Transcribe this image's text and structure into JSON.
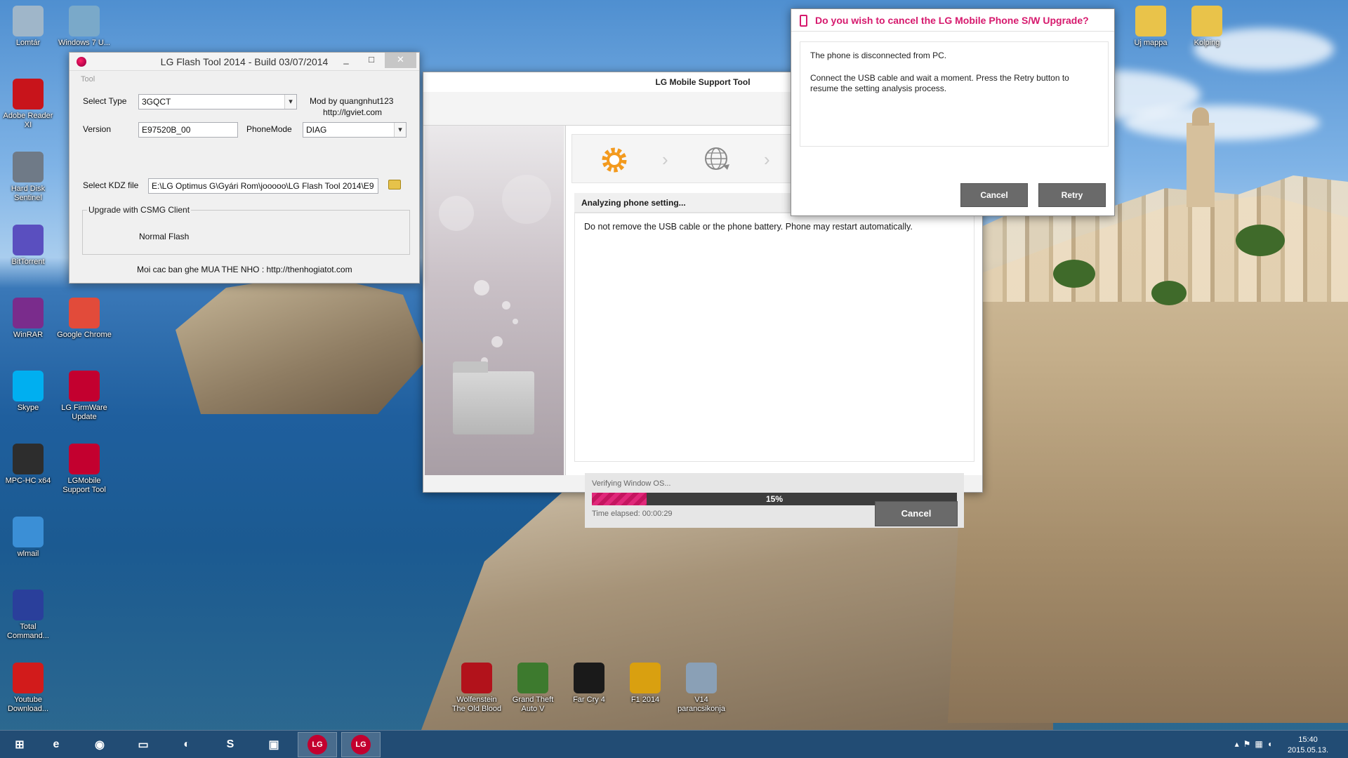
{
  "desktop": {
    "icons_left": [
      {
        "label": "Lomtár",
        "icon": "recycle-bin-icon",
        "color": "#9fb6c9"
      },
      {
        "label": "Adobe Reader XI",
        "icon": "pdf-icon",
        "color": "#c8141b"
      },
      {
        "label": "Hard Disk Sentinel",
        "icon": "hdd-icon",
        "color": "#6f7a87"
      },
      {
        "label": "BitTorrent",
        "icon": "bittorrent-icon",
        "color": "#5a4fbf"
      },
      {
        "label": "WinRAR",
        "icon": "winrar-icon",
        "color": "#7a2c8c"
      },
      {
        "label": "Skype",
        "icon": "skype-icon",
        "color": "#00aff0"
      },
      {
        "label": "MPC-HC x64",
        "icon": "media-player-icon",
        "color": "#2d2d2d"
      },
      {
        "label": "wlmail",
        "icon": "mail-icon",
        "color": "#3b8fd6"
      },
      {
        "label": "Total Command...",
        "icon": "floppy-icon",
        "color": "#2a3f9b"
      },
      {
        "label": "Youtube Download...",
        "icon": "youtube-icon",
        "color": "#d21b1b"
      }
    ],
    "icons_second": [
      {
        "label": "Windows 7 U...",
        "icon": "windows-icon",
        "color": "#7aa9c9"
      },
      {
        "label": "Google Chrome",
        "icon": "chrome-icon",
        "color": "#e24b3a"
      },
      {
        "label": "LG FirmWare Update",
        "icon": "lg-firmware-icon",
        "color": "#c3002f"
      },
      {
        "label": "LGMobile Support Tool",
        "icon": "lg-support-icon",
        "color": "#c3002f"
      }
    ],
    "icons_top_right": [
      {
        "label": "Uj mappa",
        "icon": "folder-icon",
        "color": "#e9c34a"
      },
      {
        "label": "Kolping",
        "icon": "folder-icon",
        "color": "#e9c34a"
      }
    ],
    "icons_bottom": [
      {
        "label": "Wolfenstein The Old Blood",
        "icon": "wolfenstein-icon",
        "color": "#b2121b"
      },
      {
        "label": "Grand Theft Auto V",
        "icon": "gta-icon",
        "color": "#3d7a2e"
      },
      {
        "label": "Far Cry 4",
        "icon": "farcry-icon",
        "color": "#1a1a1a"
      },
      {
        "label": "F1 2014",
        "icon": "f1-icon",
        "color": "#d9a010"
      },
      {
        "label": "V14 parancsikonja",
        "icon": "shortcut-icon",
        "color": "#8aa0b6"
      }
    ]
  },
  "flash_tool": {
    "title": "LG Flash Tool 2014 - Build 03/07/2014",
    "menu": "Tool",
    "select_type_label": "Select Type",
    "select_type_value": "3GQCT",
    "mod_by": "Mod by quangnhut123",
    "mod_url": "http://lgviet.com",
    "version_label": "Version",
    "version_value": "E97520B_00",
    "phonemode_label": "PhoneMode",
    "phonemode_value": "DIAG",
    "kdz_label": "Select KDZ file",
    "kdz_value": "E:\\LG Optimus G\\Gyári Rom\\jooooo\\LG Flash Tool 2014\\E9",
    "group_title": "Upgrade with CSMG Client",
    "normal_flash": "Normal Flash",
    "footer": "Moi cac ban ghe MUA THE NHO : http://thenhogiatot.com",
    "minimize": "_",
    "maximize": "□",
    "close": "✕"
  },
  "support_tool": {
    "title": "LG Mobile Support Tool",
    "status": "Analyzing phone setting...",
    "message": "Do not remove the USB cable or the phone battery. Phone may restart automatically.",
    "progress_label": "Verifying Window OS...",
    "progress_value": 15,
    "progress_text": "15%",
    "elapsed": "Time elapsed: 00:00:29",
    "cancel": "Cancel",
    "accent": "#e0287a"
  },
  "cancel_dialog": {
    "title": "Do you wish to cancel the LG Mobile Phone S/W Upgrade?",
    "line1": "The phone is disconnected from PC.",
    "line2": "Connect the USB cable and wait a moment. Press the Retry button to resume the setting analysis process.",
    "cancel": "Cancel",
    "retry": "Retry",
    "accent": "#d6196d"
  },
  "taskbar": {
    "items": [
      {
        "name": "start-button",
        "icon": "windows-logo-icon",
        "glyph": "⊞"
      },
      {
        "name": "taskbar-ie",
        "icon": "ie-icon",
        "glyph": "e"
      },
      {
        "name": "taskbar-chrome",
        "icon": "chrome-icon",
        "glyph": "◉"
      },
      {
        "name": "taskbar-explorer",
        "icon": "folder-icon",
        "glyph": "▭"
      },
      {
        "name": "taskbar-bittorrent",
        "icon": "bittorrent-icon",
        "glyph": "◐"
      },
      {
        "name": "taskbar-skype",
        "icon": "skype-icon",
        "glyph": "S"
      },
      {
        "name": "taskbar-totalcmd",
        "icon": "floppy-icon",
        "glyph": "▣"
      },
      {
        "name": "taskbar-lg-flash",
        "icon": "lg-icon",
        "glyph": "LG"
      },
      {
        "name": "taskbar-lg-support",
        "icon": "lg-icon",
        "glyph": "LG"
      }
    ],
    "time": "15:40",
    "date": "2015.05.13."
  }
}
